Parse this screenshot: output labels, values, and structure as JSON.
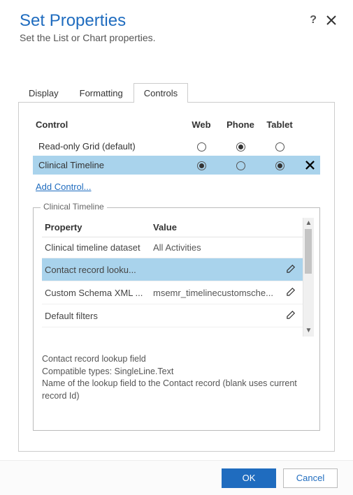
{
  "header": {
    "title": "Set Properties",
    "subtitle": "Set the List or Chart properties.",
    "help_symbol": "?"
  },
  "tabs": {
    "display": "Display",
    "formatting": "Formatting",
    "controls": "Controls"
  },
  "controls_table": {
    "head_control": "Control",
    "head_web": "Web",
    "head_phone": "Phone",
    "head_tablet": "Tablet",
    "row1_label": "Read-only Grid (default)",
    "row2_label": "Clinical Timeline",
    "add_control": "Add Control..."
  },
  "fieldset": {
    "legend": "Clinical Timeline",
    "head_property": "Property",
    "head_value": "Value",
    "rows": [
      {
        "name": "Clinical timeline dataset",
        "value": "All Activities"
      },
      {
        "name": "Contact record looku...",
        "value": ""
      },
      {
        "name": "Custom Schema XML ...",
        "value": "msemr_timelinecustomsche..."
      },
      {
        "name": "Default filters",
        "value": ""
      }
    ],
    "help_line1": "Contact record lookup field",
    "help_line2": "Compatible types: SingleLine.Text",
    "help_line3": "Name of the lookup field to the Contact record (blank uses current record Id)"
  },
  "footer": {
    "ok": "OK",
    "cancel": "Cancel"
  }
}
